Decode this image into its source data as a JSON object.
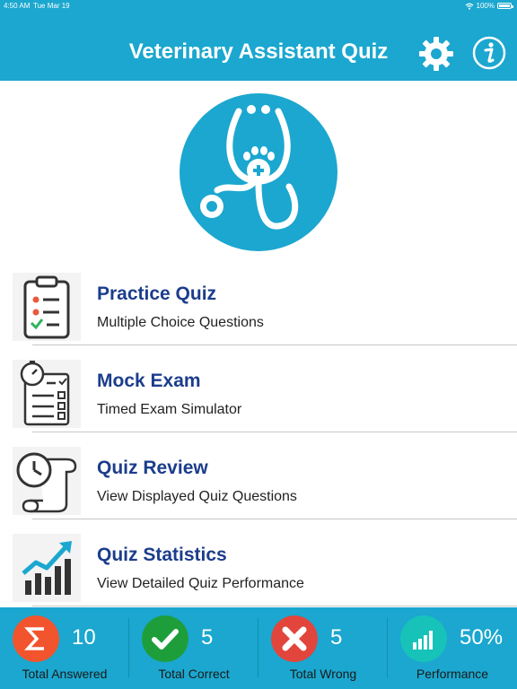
{
  "status_bar": {
    "time": "4:50 AM",
    "date": "Tue Mar 19",
    "battery": "100%"
  },
  "header": {
    "title": "Veterinary Assistant Quiz",
    "settings_icon": "gear-icon",
    "info_icon": "info-icon"
  },
  "menu": [
    {
      "title": "Practice Quiz",
      "subtitle": "Multiple Choice Questions",
      "icon": "clipboard-checklist-icon"
    },
    {
      "title": "Mock Exam",
      "subtitle": "Timed Exam Simulator",
      "icon": "stopwatch-checklist-icon"
    },
    {
      "title": "Quiz Review",
      "subtitle": "View Displayed Quiz Questions",
      "icon": "clock-scroll-icon"
    },
    {
      "title": "Quiz Statistics",
      "subtitle": "View Detailed Quiz Performance",
      "icon": "bar-chart-trend-icon"
    }
  ],
  "stats": [
    {
      "value": "10",
      "label": "Total Answered",
      "icon": "sigma-icon",
      "color": "#f2542d"
    },
    {
      "value": "5",
      "label": "Total Correct",
      "icon": "checkmark-icon",
      "color": "#1e9e3a"
    },
    {
      "value": "5",
      "label": "Total Wrong",
      "icon": "x-icon",
      "color": "#e2453c"
    },
    {
      "value": "50%",
      "label": "Performance",
      "icon": "bar-chart-icon",
      "color": "#17c3b9"
    }
  ],
  "colors": {
    "header": "#1ba7cf",
    "title_text": "#1c3d8c",
    "logo": "#1ba7cf"
  }
}
